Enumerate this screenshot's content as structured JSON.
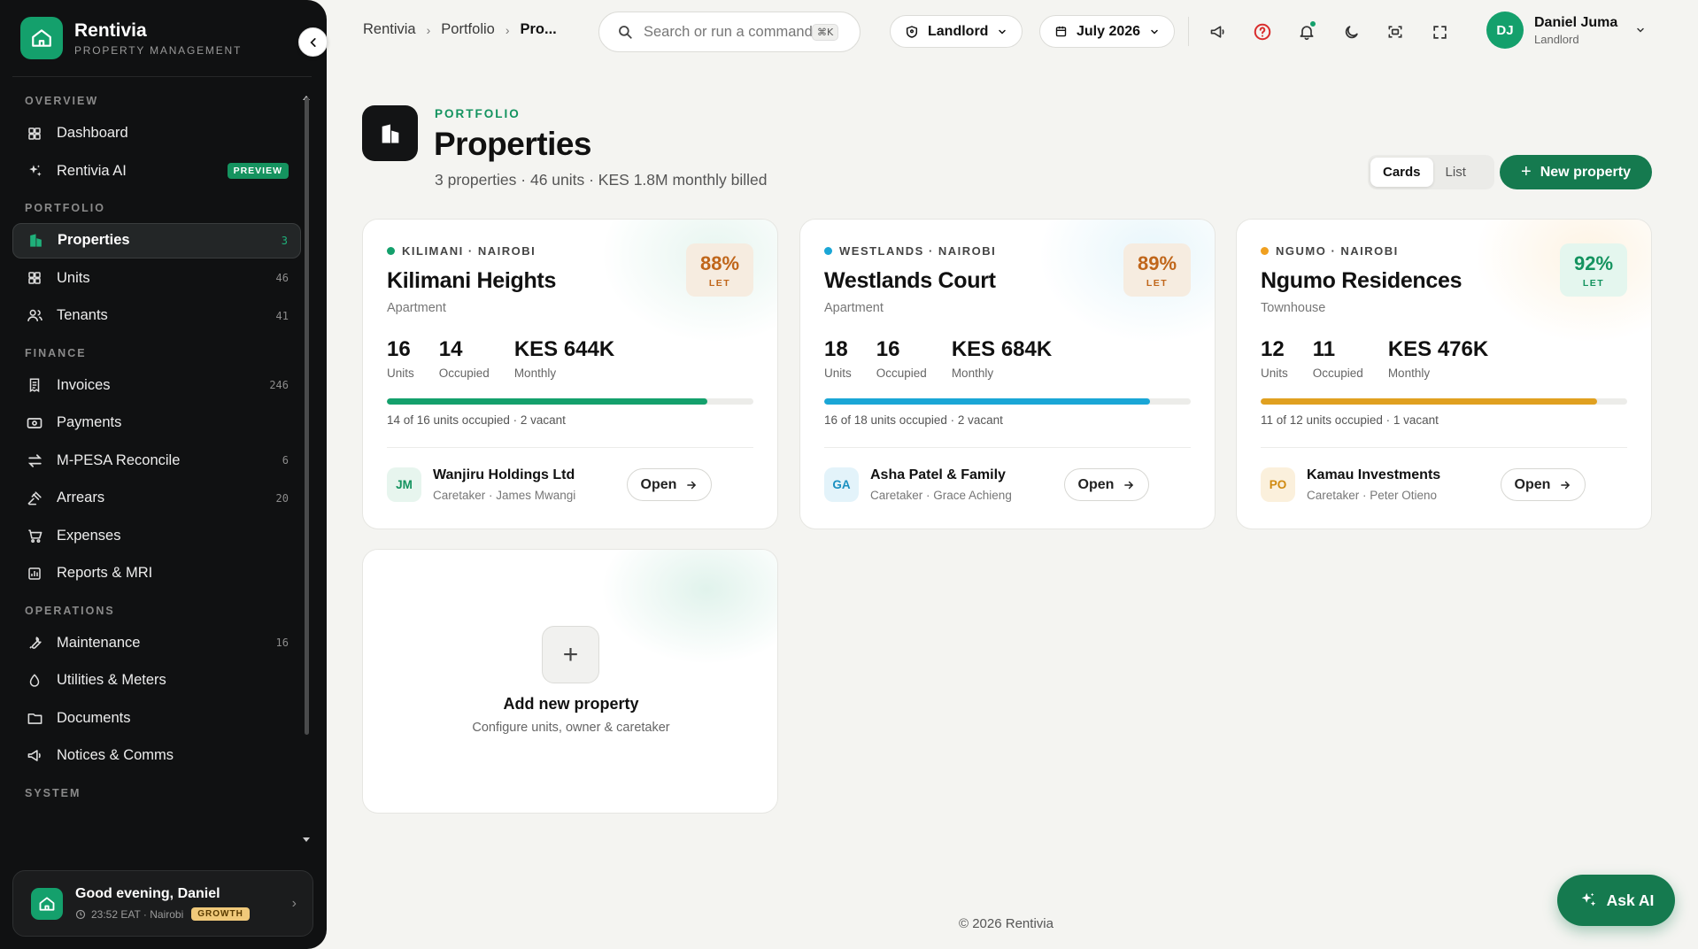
{
  "brand": {
    "name": "Rentivia",
    "subtitle": "PROPERTY MANAGEMENT"
  },
  "sidebar": {
    "sections": [
      {
        "title": "OVERVIEW",
        "items": [
          {
            "label": "Dashboard",
            "icon": "grid-icon",
            "count": ""
          },
          {
            "label": "Rentivia AI",
            "icon": "sparkle-icon",
            "count": "",
            "badge": "PREVIEW"
          }
        ]
      },
      {
        "title": "PORTFOLIO",
        "items": [
          {
            "label": "Properties",
            "icon": "building-icon",
            "count": "3",
            "active": true
          },
          {
            "label": "Units",
            "icon": "grid-icon",
            "count": "46"
          },
          {
            "label": "Tenants",
            "icon": "users-icon",
            "count": "41"
          }
        ]
      },
      {
        "title": "FINANCE",
        "items": [
          {
            "label": "Invoices",
            "icon": "invoice-icon",
            "count": "246"
          },
          {
            "label": "Payments",
            "icon": "banknote-icon",
            "count": ""
          },
          {
            "label": "M-PESA Reconcile",
            "icon": "swap-icon",
            "count": "6"
          },
          {
            "label": "Arrears",
            "icon": "gavel-icon",
            "count": "20"
          },
          {
            "label": "Expenses",
            "icon": "cart-icon",
            "count": ""
          },
          {
            "label": "Reports & MRI",
            "icon": "report-icon",
            "count": ""
          }
        ]
      },
      {
        "title": "OPERATIONS",
        "items": [
          {
            "label": "Maintenance",
            "icon": "wrench-icon",
            "count": "16"
          },
          {
            "label": "Utilities & Meters",
            "icon": "droplet-icon",
            "count": ""
          },
          {
            "label": "Documents",
            "icon": "folder-icon",
            "count": ""
          },
          {
            "label": "Notices & Comms",
            "icon": "megaphone-icon",
            "count": ""
          }
        ]
      },
      {
        "title": "SYSTEM",
        "items": []
      }
    ]
  },
  "greeting": {
    "title": "Good evening, Daniel",
    "time": "23:52 EAT · Nairobi",
    "plan": "GROWTH"
  },
  "topbar": {
    "breadcrumb": [
      "Rentivia",
      "Portfolio",
      "Pro..."
    ],
    "search_placeholder": "Search or run a command",
    "search_shortcut": "⌘K",
    "role": "Landlord",
    "period": "July 2026",
    "user": {
      "initials": "DJ",
      "name": "Daniel Juma",
      "role": "Landlord"
    }
  },
  "page": {
    "eyebrow": "PORTFOLIO",
    "title": "Properties",
    "subtitle": "3 properties · 46 units · KES 1.8M monthly billed",
    "view_options": [
      "Cards",
      "List"
    ],
    "new_button": "New property"
  },
  "properties": [
    {
      "location": "KILIMANI · NAIROBI",
      "name": "Kilimani Heights",
      "type": "Apartment",
      "let_pct": "88%",
      "let_label": "LET",
      "occupancy": 0.875,
      "stats": [
        {
          "value": "16",
          "label": "Units"
        },
        {
          "value": "14",
          "label": "Occupied"
        },
        {
          "value": "KES 644K",
          "label": "Monthly"
        }
      ],
      "occupancy_text": "14 of 16 units occupied · 2 vacant",
      "owner_initials": "JM",
      "owner": "Wanjiru Holdings Ltd",
      "caretaker": "Caretaker · James Mwangi",
      "open_label": "Open",
      "colors": {
        "dot": "#14a06c",
        "badge_bg": "#f6ece0",
        "badge_fg": "#c0661a",
        "bar": "#14a06c",
        "av_bg": "#e7f5ee",
        "av_fg": "#14935f",
        "glow": "rgba(20,160,108,.10)"
      }
    },
    {
      "location": "WESTLANDS · NAIROBI",
      "name": "Westlands Court",
      "type": "Apartment",
      "let_pct": "89%",
      "let_label": "LET",
      "occupancy": 0.889,
      "stats": [
        {
          "value": "18",
          "label": "Units"
        },
        {
          "value": "16",
          "label": "Occupied"
        },
        {
          "value": "KES 684K",
          "label": "Monthly"
        }
      ],
      "occupancy_text": "16 of 18 units occupied · 2 vacant",
      "owner_initials": "GA",
      "owner": "Asha Patel & Family",
      "caretaker": "Caretaker · Grace Achieng",
      "open_label": "Open",
      "colors": {
        "dot": "#1aa6d6",
        "badge_bg": "#f6ece0",
        "badge_fg": "#c0661a",
        "bar": "#1aa6d6",
        "av_bg": "#e3f3fa",
        "av_fg": "#1a8fc0",
        "glow": "rgba(26,166,214,.10)"
      }
    },
    {
      "location": "NGUMO · NAIROBI",
      "name": "Ngumo Residences",
      "type": "Townhouse",
      "let_pct": "92%",
      "let_label": "LET",
      "occupancy": 0.917,
      "stats": [
        {
          "value": "12",
          "label": "Units"
        },
        {
          "value": "11",
          "label": "Occupied"
        },
        {
          "value": "KES 476K",
          "label": "Monthly"
        }
      ],
      "occupancy_text": "11 of 12 units occupied · 1 vacant",
      "owner_initials": "PO",
      "owner": "Kamau Investments",
      "caretaker": "Caretaker · Peter Otieno",
      "open_label": "Open",
      "colors": {
        "dot": "#f0a020",
        "badge_bg": "#e4f6ee",
        "badge_fg": "#14935f",
        "bar": "#e0a020",
        "av_bg": "#fbf0dc",
        "av_fg": "#d08a10",
        "glow": "rgba(240,160,32,.12)"
      }
    }
  ],
  "add_card": {
    "title": "Add new property",
    "subtitle": "Configure units, owner & caretaker"
  },
  "footer": "© 2026 Rentivia",
  "ask_ai": "Ask AI"
}
